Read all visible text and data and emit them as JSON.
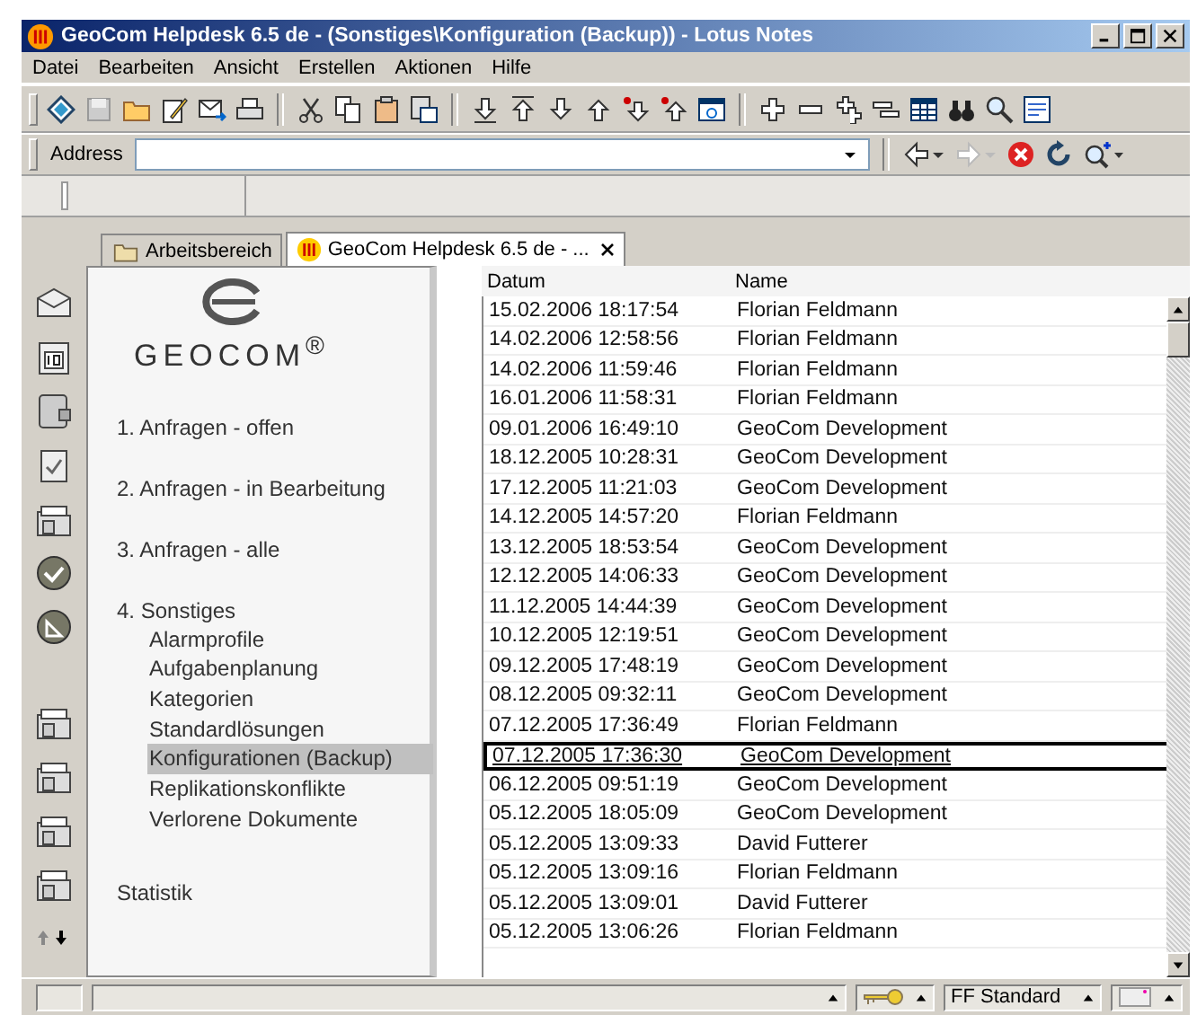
{
  "window": {
    "title": "GeoCom Helpdesk 6.5 de - (Sonstiges\\Konfiguration (Backup)) - Lotus Notes"
  },
  "menu": [
    "Datei",
    "Bearbeiten",
    "Ansicht",
    "Erstellen",
    "Aktionen",
    "Hilfe"
  ],
  "address": {
    "label": "Address"
  },
  "tabs": [
    {
      "label": "Arbeitsbereich",
      "selected": false
    },
    {
      "label": "GeoCom Helpdesk 6.5 de - ...",
      "selected": true
    }
  ],
  "navigator": {
    "logo": "GEOCOM$^{®}$",
    "items": [
      {
        "label": "1. Anfragen - offen",
        "selected": false
      },
      {
        "label": "2. Anfragen - in Bearbeitung",
        "selected": false
      },
      {
        "label": "3. Anfragen - alle",
        "selected": false
      },
      {
        "label": "4. Sonstiges",
        "selected": false,
        "children": [
          {
            "label": "Alarmprofile",
            "selected": false
          },
          {
            "label": "Aufgabenplanung",
            "selected": false
          },
          {
            "label": "Kategorien",
            "selected": false
          },
          {
            "label": "Standardlösungen",
            "selected": false
          },
          {
            "label": "Konfigurationen (Backup)",
            "selected": true
          },
          {
            "label": "Replikationskonflikte",
            "selected": false
          },
          {
            "label": "Verlorene Dokumente",
            "selected": false
          }
        ]
      },
      {
        "label": "Statistik",
        "selected": false
      }
    ]
  },
  "view": {
    "columns": [
      "Datum",
      "Name"
    ],
    "rows": [
      {
        "cells": [
          "15.02.2006 18:17:54",
          "Florian Feldmann"
        ],
        "selected": false
      },
      {
        "cells": [
          "14.02.2006 12:58:56",
          "Florian Feldmann"
        ],
        "selected": false
      },
      {
        "cells": [
          "14.02.2006 11:59:46",
          "Florian Feldmann"
        ],
        "selected": false
      },
      {
        "cells": [
          "16.01.2006 11:58:31",
          "Florian Feldmann"
        ],
        "selected": false
      },
      {
        "cells": [
          "09.01.2006 16:49:10",
          "GeoCom Development"
        ],
        "selected": false
      },
      {
        "cells": [
          "18.12.2005 10:28:31",
          "GeoCom Development"
        ],
        "selected": false
      },
      {
        "cells": [
          "17.12.2005 11:21:03",
          "GeoCom Development"
        ],
        "selected": false
      },
      {
        "cells": [
          "14.12.2005 14:57:20",
          "Florian Feldmann"
        ],
        "selected": false
      },
      {
        "cells": [
          "13.12.2005 18:53:54",
          "GeoCom Development"
        ],
        "selected": false
      },
      {
        "cells": [
          "12.12.2005 14:06:33",
          "GeoCom Development"
        ],
        "selected": false
      },
      {
        "cells": [
          "11.12.2005 14:44:39",
          "GeoCom Development"
        ],
        "selected": false
      },
      {
        "cells": [
          "10.12.2005 12:19:51",
          "GeoCom Development"
        ],
        "selected": false
      },
      {
        "cells": [
          "09.12.2005 17:48:19",
          "GeoCom Development"
        ],
        "selected": false
      },
      {
        "cells": [
          "08.12.2005 09:32:11",
          "GeoCom Development"
        ],
        "selected": false
      },
      {
        "cells": [
          "07.12.2005 17:36:49",
          "Florian Feldmann"
        ],
        "selected": false
      },
      {
        "cells": [
          "07.12.2005 17:36:30",
          "GeoCom Development"
        ],
        "selected": true
      },
      {
        "cells": [
          "06.12.2005 09:51:19",
          "GeoCom Development"
        ],
        "selected": false
      },
      {
        "cells": [
          "05.12.2005 18:05:09",
          "GeoCom Development"
        ],
        "selected": false
      },
      {
        "cells": [
          "05.12.2005 13:09:33",
          "David Futterer"
        ],
        "selected": false
      },
      {
        "cells": [
          "05.12.2005 13:09:16",
          "Florian Feldmann"
        ],
        "selected": false
      },
      {
        "cells": [
          "05.12.2005 13:09:01",
          "David Futterer"
        ],
        "selected": false
      },
      {
        "cells": [
          "05.12.2005 13:06:26",
          "Florian Feldmann"
        ],
        "selected": false
      }
    ]
  },
  "status_bar": {
    "location": "FF Standard"
  }
}
